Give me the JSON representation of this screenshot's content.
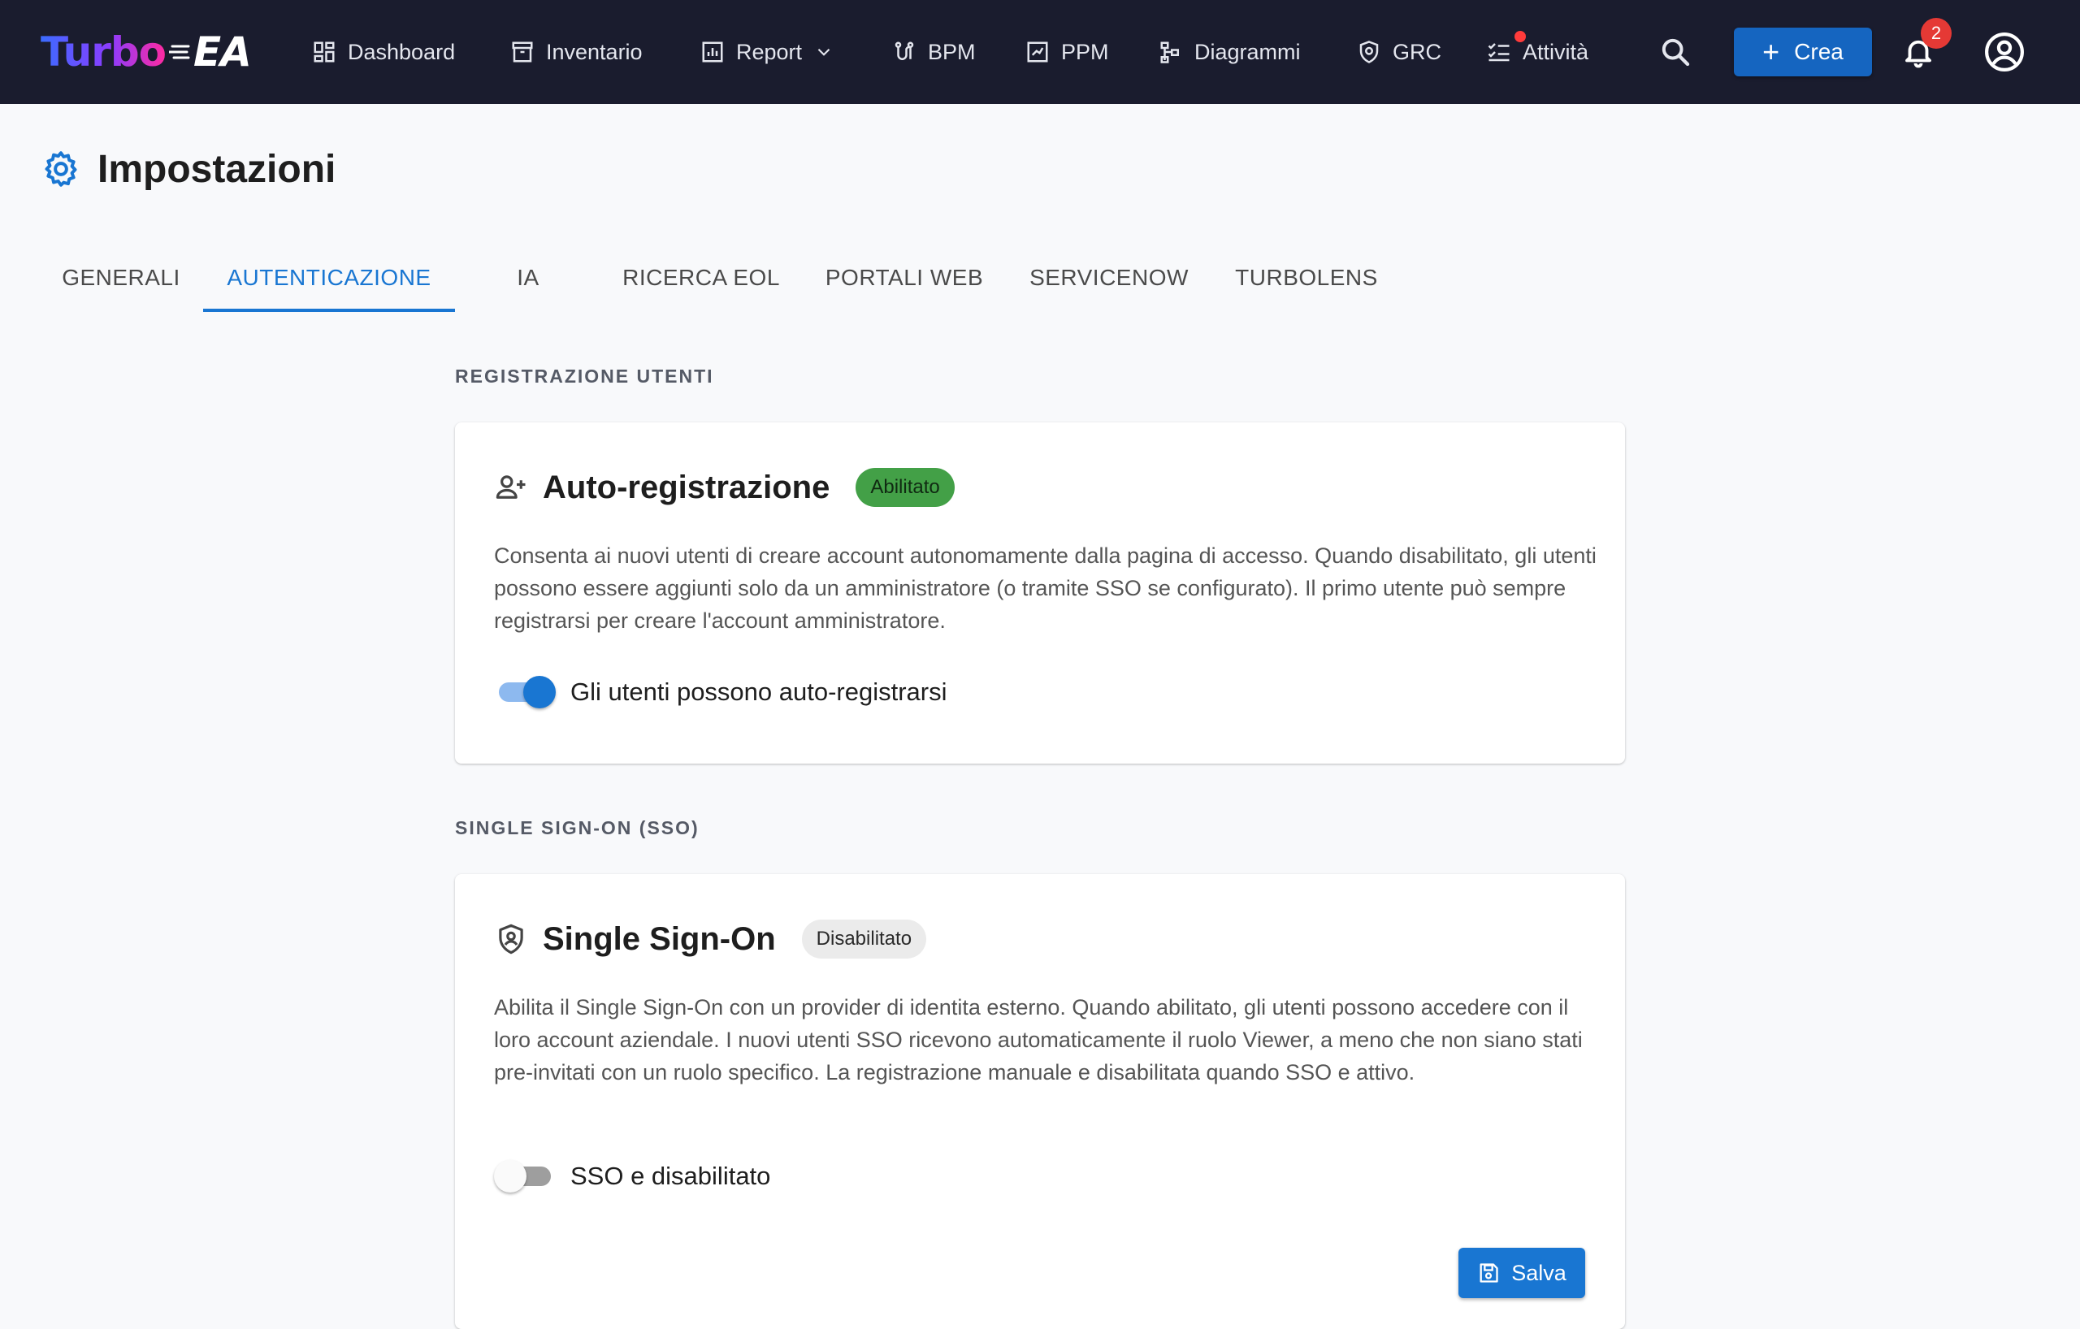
{
  "app": {
    "logo_turbo": "Turbo",
    "logo_ea": "EA"
  },
  "nav": {
    "items": [
      {
        "label": "Dashboard",
        "icon": "dashboard-icon"
      },
      {
        "label": "Inventario",
        "icon": "inventory-icon"
      },
      {
        "label": "Report",
        "icon": "report-icon",
        "has_dropdown": true
      },
      {
        "label": "BPM",
        "icon": "bpm-icon"
      },
      {
        "label": "PPM",
        "icon": "ppm-icon"
      },
      {
        "label": "Diagrammi",
        "icon": "diagram-icon"
      },
      {
        "label": "GRC",
        "icon": "shield-icon"
      },
      {
        "label": "Attività",
        "icon": "tasks-icon",
        "has_indicator_dot": true
      }
    ],
    "create_label": "Crea",
    "notification_count": "2"
  },
  "page": {
    "title": "Impostazioni"
  },
  "tabs": [
    {
      "label": "GENERALI",
      "active": false
    },
    {
      "label": "AUTENTICAZIONE",
      "active": true
    },
    {
      "label": "IA",
      "active": false
    },
    {
      "label": "RICERCA EOL",
      "active": false
    },
    {
      "label": "PORTALI WEB",
      "active": false
    },
    {
      "label": "SERVICENOW",
      "active": false
    },
    {
      "label": "TURBOLENS",
      "active": false
    }
  ],
  "registration": {
    "section_label": "REGISTRAZIONE UTENTI",
    "title": "Auto-registrazione",
    "status": "Abilitato",
    "description": "Consenta ai nuovi utenti di creare account autonomamente dalla pagina di accesso. Quando disabilitato, gli utenti possono essere aggiunti solo da un amministratore (o tramite SSO se configurato). Il primo utente può sempre registrarsi per creare l'account amministratore.",
    "toggle_label": "Gli utenti possono auto-registrarsi",
    "toggle_on": true
  },
  "sso": {
    "section_label": "SINGLE SIGN-ON (SSO)",
    "title": "Single Sign-On",
    "status": "Disabilitato",
    "description": "Abilita il Single Sign-On con un provider di identita esterno. Quando abilitato, gli utenti possono accedere con il loro account aziendale. I nuovi utenti SSO ricevono automaticamente il ruolo Viewer, a meno che non siano stati pre-invitati con un ruolo specifico. La registrazione manuale e disabilitata quando SSO e attivo.",
    "toggle_label": "SSO e disabilitato",
    "toggle_on": false,
    "save_label": "Salva"
  },
  "colors": {
    "topbar": "#1a1c2e",
    "accent": "#1976d2",
    "enabled_chip": "#43a047",
    "disabled_chip": "#ebebeb",
    "badge": "#e53935"
  }
}
